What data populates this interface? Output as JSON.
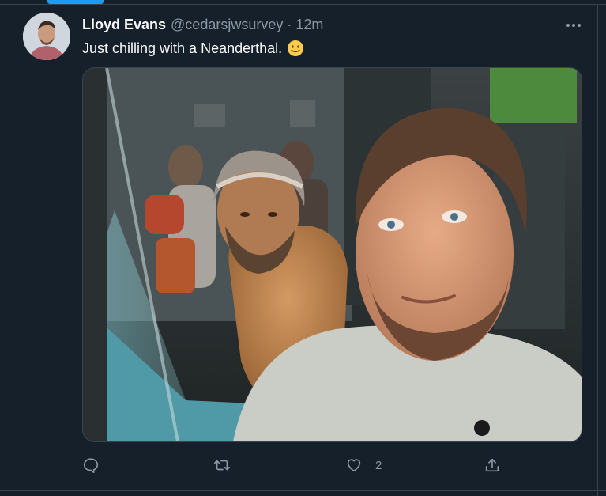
{
  "tweet": {
    "author": {
      "display_name": "Lloyd Evans",
      "handle": "@cedarsjwsurvey"
    },
    "separator": "·",
    "timestamp": "12m",
    "text": "Just chilling with a Neanderthal.",
    "emoji": "slightly-smiling-face",
    "more_icon": "ellipsis-icon",
    "media": {
      "kind": "photo"
    },
    "actions": {
      "reply": {
        "icon": "reply-icon"
      },
      "retweet": {
        "icon": "retweet-icon"
      },
      "like": {
        "icon": "heart-icon",
        "count": "2"
      },
      "share": {
        "icon": "share-icon"
      }
    }
  },
  "colors": {
    "background": "#15202b",
    "text_primary": "#f7f9f9",
    "text_secondary": "#8b98a5",
    "accent": "#1d9bf0",
    "divider": "#38444d"
  }
}
